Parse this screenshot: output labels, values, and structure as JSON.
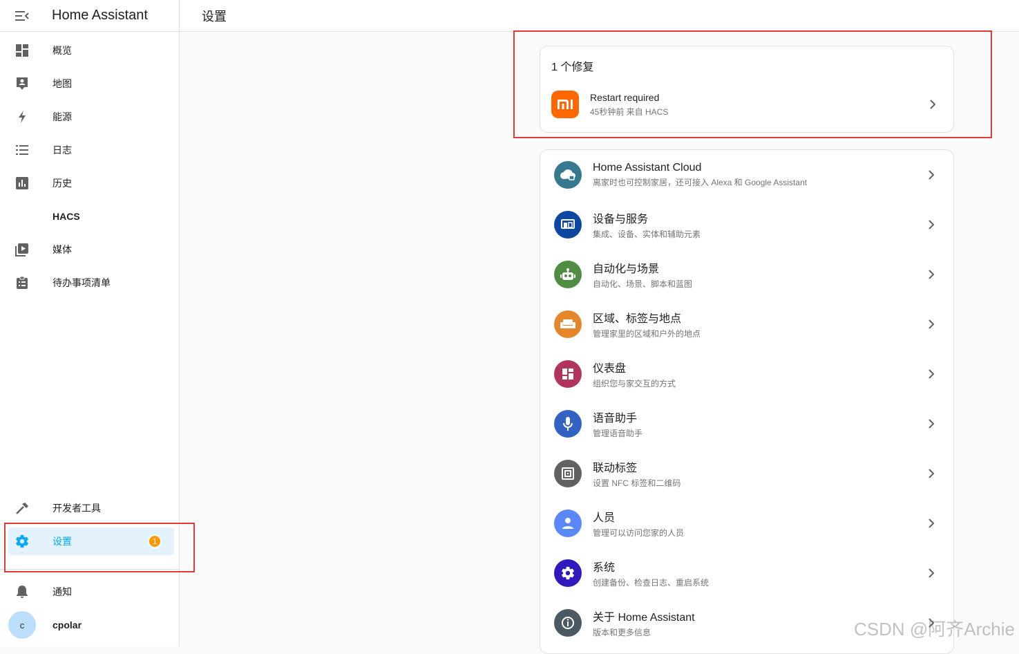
{
  "sidebar": {
    "app_title": "Home Assistant",
    "items": [
      {
        "label": "概览",
        "icon": "dashboard-icon"
      },
      {
        "label": "地图",
        "icon": "map-account-icon"
      },
      {
        "label": "能源",
        "icon": "lightning-icon"
      },
      {
        "label": "日志",
        "icon": "format-list-icon"
      },
      {
        "label": "历史",
        "icon": "chart-box-icon"
      },
      {
        "label": "HACS",
        "icon": ""
      },
      {
        "label": "媒体",
        "icon": "play-box-icon"
      },
      {
        "label": "待办事项清单",
        "icon": "clipboard-list-icon"
      }
    ],
    "developer_tools": "开发者工具",
    "settings": "设置",
    "settings_badge": "1",
    "notifications": "通知",
    "user_name": "cpolar",
    "user_initial": "c"
  },
  "topbar": {
    "title": "设置"
  },
  "repairs": {
    "title": "1 个修复",
    "item": {
      "title": "Restart required",
      "subtitle": "45秒钟前 来自 HACS"
    }
  },
  "settings_items": [
    {
      "title": "Home Assistant Cloud",
      "subtitle": "离家时也可控制家居，还可接入 Alexa 和 Google Assistant",
      "color": "#37798e",
      "icon": "cloud-lock-icon"
    },
    {
      "title": "设备与服务",
      "subtitle": "集成、设备、实体和辅助元素",
      "color": "#0d47a1",
      "icon": "devices-icon"
    },
    {
      "title": "自动化与场景",
      "subtitle": "自动化、场景、脚本和蓝图",
      "color": "#518c43",
      "icon": "robot-icon"
    },
    {
      "title": "区域、标签与地点",
      "subtitle": "管理家里的区域和户外的地点",
      "color": "#e48629",
      "icon": "sofa-icon"
    },
    {
      "title": "仪表盘",
      "subtitle": "组织您与家交互的方式",
      "color": "#b1345c",
      "icon": "view-dashboard-icon"
    },
    {
      "title": "语音助手",
      "subtitle": "管理语音助手",
      "color": "#3263c3",
      "icon": "microphone-icon"
    },
    {
      "title": "联动标签",
      "subtitle": "设置 NFC 标签和二维码",
      "color": "#616161",
      "icon": "nfc-icon"
    },
    {
      "title": "人员",
      "subtitle": "管理可以访问您家的人员",
      "color": "#5a87fa",
      "icon": "account-icon"
    },
    {
      "title": "系统",
      "subtitle": "创建备份、检查日志、重启系统",
      "color": "#301ABE",
      "icon": "cog-icon"
    },
    {
      "title": "关于 Home Assistant",
      "subtitle": "版本和更多信息",
      "color": "#4a5963",
      "icon": "info-icon"
    }
  ],
  "watermark": "CSDN @阿齐Archie"
}
